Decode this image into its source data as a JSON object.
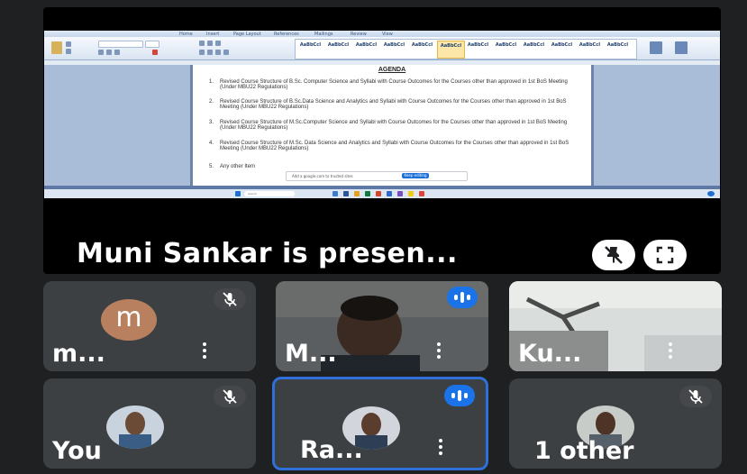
{
  "presentation": {
    "label": "Muni Sankar is presen...",
    "shared_doc": {
      "tabs": [
        "Home",
        "Insert",
        "Page Layout",
        "References",
        "Mailings",
        "Review",
        "View"
      ],
      "styles": [
        "AaBbCcI",
        "AaBbCcI",
        "AaBbCcI",
        "AaBbCcI",
        "AaBbCcI",
        "AaBbCcI",
        "AaBbCcI",
        "AaBbCcI",
        "AaBbCcI",
        "AaBbCcI",
        "AaBbCcI",
        "AaBbCcI"
      ],
      "agenda_title": "AGENDA",
      "agenda_items": [
        {
          "num": "1.",
          "text": "Revised Course Structure of B.Sc. Computer Science and Syllabi with Course Outcomes for the Courses other than approved in 1st BoS Meeting (Under MBU22 Regulations)"
        },
        {
          "num": "2.",
          "text": "Revised Course Structure of B.Sc.Data Science and Analytics and Syllabi with Course Outcomes for the Courses other than approved in 1st BoS Meeting (Under MBU22 Regulations)"
        },
        {
          "num": "3.",
          "text": "Revised Course Structure of M.Sc.Computer Science and Syllabi with Course Outcomes for the Courses other than approved in 1st BoS Meeting (Under MBU22 Regulations)"
        },
        {
          "num": "4.",
          "text": "Revised Course Structure of M.Sc. Data Science and Analytics and Syllabi with Course Outcomes for the Courses other than approved in 1st BoS Meeting (Under MBU22 Regulations)"
        },
        {
          "num": "5.",
          "text": "Any other Item"
        }
      ],
      "toast_text": "Add a google.com to trusted sites",
      "toast_button": "Keep editing",
      "search_placeholder": "Search"
    }
  },
  "participants": [
    {
      "name": "m...",
      "avatar_letter": "m",
      "avatar_color": "#b98060",
      "muted": true
    },
    {
      "name": "M...",
      "speaking": true
    },
    {
      "name": "Ku..."
    },
    {
      "name": "You",
      "muted": true
    },
    {
      "name": "Ra...",
      "speaking": true,
      "active_speaker_border": "#2e6fd8"
    },
    {
      "name": "1 other",
      "muted": true
    }
  ],
  "colors": {
    "background": "#1f2022",
    "tile": "#3c4043",
    "speaking": "#1a73e8"
  }
}
